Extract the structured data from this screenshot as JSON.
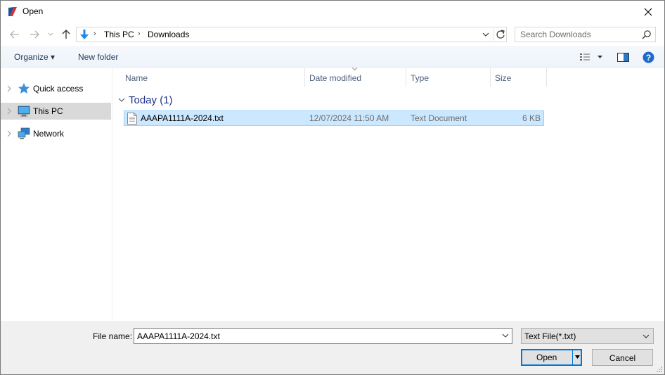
{
  "window": {
    "title": "Open",
    "close_icon": "close-icon",
    "app_icon": "app-logo-icon"
  },
  "nav": {
    "back_icon": "arrow-left-icon",
    "forward_icon": "arrow-right-icon",
    "recent_icon": "chevron-down-icon",
    "up_icon": "arrow-up-icon"
  },
  "address": {
    "location_icon": "download-arrow-icon",
    "crumbs": [
      "This PC",
      "Downloads"
    ],
    "separator": "›",
    "dropdown_icon": "chevron-down-icon",
    "refresh_icon": "refresh-icon"
  },
  "search": {
    "placeholder": "Search Downloads",
    "icon": "search-icon"
  },
  "toolbar": {
    "organize_label": "Organize ▾",
    "new_folder_label": "New folder",
    "view_icon": "details-view-icon",
    "preview_icon": "preview-pane-icon",
    "help_icon": "help-icon"
  },
  "sidebar": {
    "items": [
      {
        "label": "Quick access",
        "icon": "star-icon",
        "selected": false
      },
      {
        "label": "This PC",
        "icon": "computer-icon",
        "selected": true
      },
      {
        "label": "Network",
        "icon": "network-icon",
        "selected": false
      }
    ]
  },
  "columns": [
    "Name",
    "Date modified",
    "Type",
    "Size"
  ],
  "group": {
    "label": "Today (1)"
  },
  "files": [
    {
      "name": "AAAPA1111A-2024.txt",
      "date": "12/07/2024 11:50 AM",
      "type": "Text Document",
      "size": "6 KB",
      "icon": "text-file-icon"
    }
  ],
  "bottom": {
    "file_name_label": "File name:",
    "file_name_value": "AAAPA1111A-2024.txt",
    "file_type_value": "Text File(*.txt)",
    "open_label": "Open",
    "cancel_label": "Cancel"
  },
  "colors": {
    "accent": "#0078d7",
    "selection": "#cce8ff",
    "group_text": "#1e3287",
    "toolbar_text": "#1e395b"
  }
}
